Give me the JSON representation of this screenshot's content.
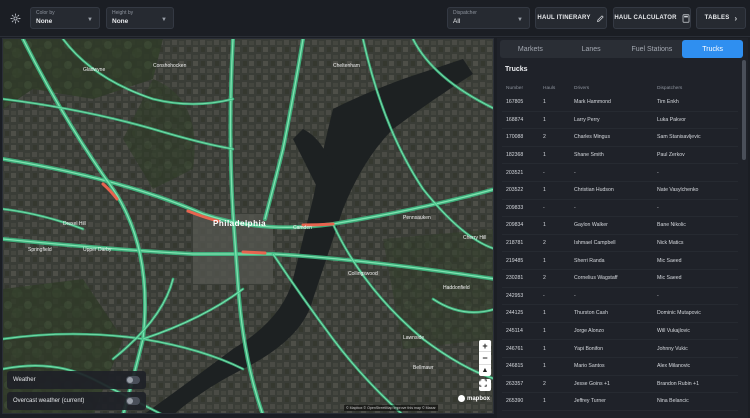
{
  "toolbar": {
    "color_by": {
      "label": "Color by",
      "value": "None"
    },
    "height_by": {
      "label": "Height by",
      "value": "None"
    },
    "dispatcher": {
      "label": "Dispatcher",
      "value": "All"
    },
    "haul_itinerary": "HAUL ITINERARY",
    "haul_calculator": "HAUL CALCULATOR",
    "tables": "TABLES"
  },
  "map": {
    "city_label": "Philadelphia",
    "labels": [
      "Gladwyne",
      "Conshohocken",
      "Drexel Hill",
      "Springfield",
      "Upper Darby",
      "Collingswood",
      "Pennsauken",
      "Lawnside",
      "Haddonfield",
      "Bellmawr",
      "Camden",
      "Cherry Hill",
      "Cheltenham"
    ],
    "layers": [
      {
        "label": "Weather"
      },
      {
        "label": "Overcast weather (current)"
      }
    ],
    "attribution": "© Mapbox © OpenStreetMap Improve this map © Maxar",
    "logo": "mapbox"
  },
  "panel": {
    "tabs": [
      {
        "label": "Markets",
        "active": false
      },
      {
        "label": "Lanes",
        "active": false
      },
      {
        "label": "Fuel Stations",
        "active": false
      },
      {
        "label": "Trucks",
        "active": true
      }
    ],
    "title": "Trucks",
    "columns": [
      "Number",
      "Hauls",
      "Drivers",
      "Dispatchers"
    ],
    "rows": [
      [
        "167805",
        "1",
        "Mark Hammond",
        "Tim Enkh"
      ],
      [
        "168874",
        "1",
        "Larry Perry",
        "Luka Pakvor"
      ],
      [
        "170088",
        "2",
        "Charles Mingus",
        "Sam Stanisavljevic"
      ],
      [
        "182368",
        "1",
        "Shane Smith",
        "Paul Zerkov"
      ],
      [
        "203521",
        "-",
        "-",
        "-"
      ],
      [
        "203522",
        "1",
        "Christian Hudson",
        "Nate Vasylchenko"
      ],
      [
        "209833",
        "-",
        "-",
        "-"
      ],
      [
        "209834",
        "1",
        "Gaylon Walker",
        "Bane Nikolic"
      ],
      [
        "218781",
        "2",
        "Ishmael Campbell",
        "Nick Matics"
      ],
      [
        "219485",
        "1",
        "Sherri Randa",
        "Mic Saeed"
      ],
      [
        "230281",
        "2",
        "Cornelius Wagstaff",
        "Mic Saeed"
      ],
      [
        "242953",
        "-",
        "-",
        "-"
      ],
      [
        "244125",
        "1",
        "Thurston Cash",
        "Dominic Mutapovic"
      ],
      [
        "245114",
        "1",
        "Jorge Alonzo",
        "Will Vukajlovic"
      ],
      [
        "246761",
        "1",
        "Yapi Bonifon",
        "Johnny Vukic"
      ],
      [
        "246815",
        "1",
        "Mario Santos",
        "Alex Milanovic"
      ],
      [
        "263357",
        "2",
        "Jesse Goins +1",
        "Brandon Rubin +1"
      ],
      [
        "265390",
        "1",
        "Jeffrey Turner",
        "Nina Belancic"
      ]
    ]
  }
}
